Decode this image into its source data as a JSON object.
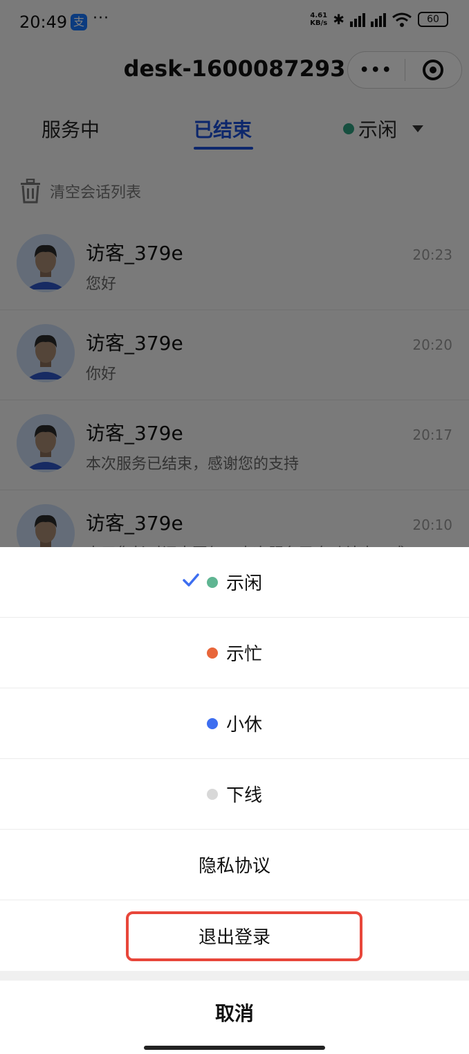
{
  "status_bar": {
    "time": "20:49",
    "app_icon": "支",
    "more": "···",
    "speed_value": "4.61",
    "speed_unit": "KB/s",
    "battery": "60"
  },
  "header": {
    "title": "desk-1600087293"
  },
  "tabs": {
    "serving": "服务中",
    "ended": "已结束",
    "status": "示闲",
    "status_color": "#2c9e7e"
  },
  "clear": {
    "label": "清空会话列表"
  },
  "conversations": [
    {
      "name": "访客_379e",
      "message": "您好",
      "time": "20:23"
    },
    {
      "name": "访客_379e",
      "message": "你好",
      "time": "20:20"
    },
    {
      "name": "访客_379e",
      "message": "本次服务已结束，感谢您的支持",
      "time": "20:17"
    },
    {
      "name": "访客_379e",
      "message": "由于您长时间未回复，本次服务已自动结束，感",
      "time": "20:10"
    }
  ],
  "sheet": {
    "items": [
      {
        "label": "示闲",
        "color": "#5fb592",
        "selected": true
      },
      {
        "label": "示忙",
        "color": "#e8663a",
        "selected": false
      },
      {
        "label": "小休",
        "color": "#3d6ef0",
        "selected": false
      },
      {
        "label": "下线",
        "color": "#d8d8d8",
        "selected": false
      }
    ],
    "privacy": "隐私协议",
    "logout": "退出登录",
    "cancel": "取消",
    "highlight_color": "#e8463a"
  }
}
